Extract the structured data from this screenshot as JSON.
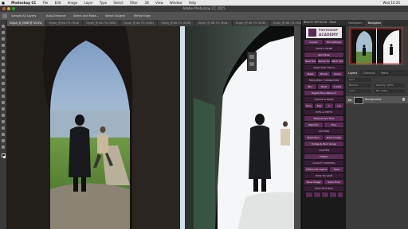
{
  "menubar": {
    "items": [
      "Photoshop CC",
      "File",
      "Edit",
      "Image",
      "Layer",
      "Type",
      "Select",
      "Filter",
      "3D",
      "View",
      "Window",
      "Help"
    ],
    "right": "Wed 10:26"
  },
  "window": {
    "title": "Adobe Photoshop CC 2015"
  },
  "options_bar": {
    "items": [
      "Sample All Layers",
      "Auto-Enhance",
      "Select and Mask...",
      "Select Subject",
      "Refine Edge"
    ]
  },
  "doc_tabs": [
    "Glyph_8_3906 @ 33.3%",
    "Glyph_@ 66.7% (RGB)",
    "Glyph_@ 66.7% (RGB)",
    "Glyph_@ 66.7% (RGB)",
    "Glyph_@ 66.7% (RGB)",
    "Glyph_@ 66.7% (RGB)",
    "Glyph_@ 66.7% (RGB)",
    "Glyph_@ 66.7% (RGB)",
    "Glyph_@ 66.7% (RGB)"
  ],
  "plugin": {
    "header": "BEAUTY RETOUCH - Panel",
    "logo_line1": "PHOTOSHOP",
    "logo_line2": "ACADEMY",
    "btn_row1": [
      "Layers",
      "File Settings"
    ],
    "sections": [
      "CODE A NAME",
      "SELECTIVE TOOLS",
      "CODE A NAME",
      "FREQUENCY SEPARATION",
      "DODGE & BURN",
      "EYES & TEETH",
      "ACTIONS",
      "LIGHTEN",
      "CLEANUP",
      "QUALITY CONTROL",
      "HOW TO SAVE",
      "HIGH SETTINGS"
    ],
    "buttons": [
      [
        "Heal Tool",
        "Stamp Tool",
        "Patch Tool"
      ],
      [
        "Spot Heal"
      ],
      [
        "Mask",
        "Brush",
        "Clone"
      ],
      [
        "Blur",
        "Mask",
        "Create"
      ],
      [
        "Digital Face Retouch"
      ],
      [
        "Face",
        "Eye",
        "1",
        "Lip"
      ],
      [
        "Magical Eye Tone"
      ],
      [
        "Blemish",
        "Fine"
      ],
      [
        "Mask Burn",
        "Mask Dodge"
      ],
      [
        "Dodge & Burn Group"
      ],
      [
        "Flatten"
      ],
      [
        "Flatten All Layers",
        "Save"
      ],
      [
        "Save Image",
        "Save Final"
      ]
    ]
  },
  "right_panels": {
    "top_tabs": [
      "Histogram",
      "Navigator"
    ],
    "layer_tabs": [
      "Layers",
      "Channels",
      "Paths"
    ],
    "layer_name": "Background",
    "controls": [
      "Kind",
      "Normal",
      "Opacity: 100%",
      "Lock:",
      "Fill: 100%"
    ]
  }
}
